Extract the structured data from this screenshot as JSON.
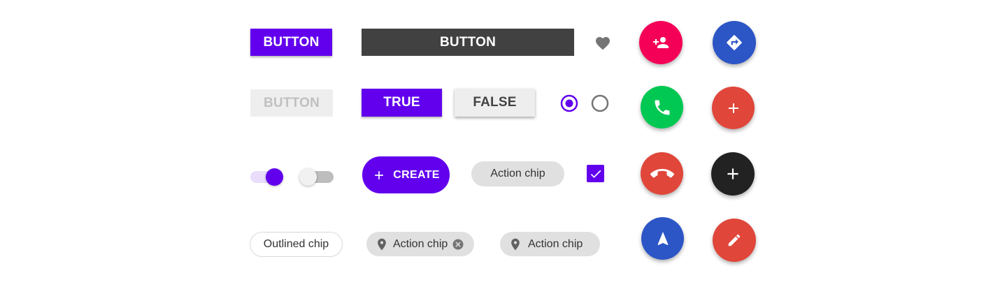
{
  "buttons": {
    "contained_label": "BUTTON",
    "wide_label": "BUTTON",
    "disabled_label": "BUTTON"
  },
  "toggle_group": {
    "true_label": "TRUE",
    "false_label": "FALSE",
    "selected": "TRUE"
  },
  "radio": {
    "options_count": 2,
    "selected_index": 0
  },
  "switches": [
    {
      "state": "on"
    },
    {
      "state": "off"
    }
  ],
  "extended_fab": {
    "icon": "plus-icon",
    "label": "CREATE"
  },
  "chips": {
    "action_chip_label": "Action chip",
    "outlined_chip_label": "Outlined chip",
    "location_chip_removable_label": "Action chip",
    "location_chip_label": "Action chip"
  },
  "checkbox": {
    "checked": true
  },
  "icons": {
    "favorite": "heart-icon",
    "add_person": "person-add-icon",
    "directions": "directions-icon",
    "call": "phone-icon",
    "end_call": "call-end-icon",
    "add": "plus-icon",
    "navigation": "navigation-arrow-icon",
    "edit": "pencil-icon",
    "location": "location-pin-icon",
    "cancel": "cancel-icon"
  },
  "colors": {
    "primary": "#6200ee",
    "dark_button": "#414141",
    "pink": "#f50057",
    "blue": "#2c55c6",
    "green": "#00c853",
    "red": "#e0463a",
    "black": "#222222",
    "chip_gray": "#e0e0e0"
  }
}
